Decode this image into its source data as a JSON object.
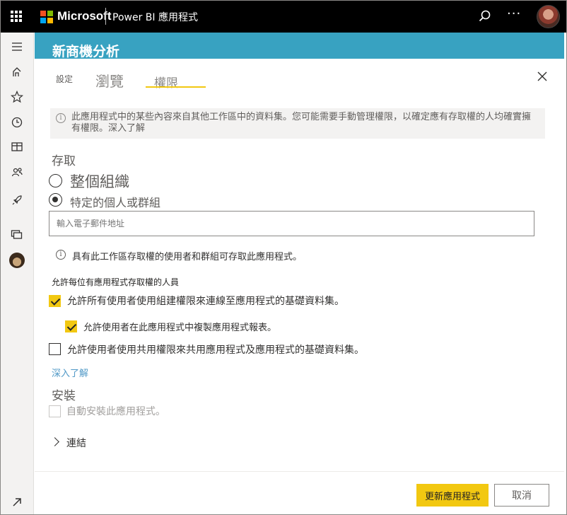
{
  "topbar": {
    "brand": "Microsoft",
    "app_name": "Power BI 應用程式",
    "more_glyph": "···"
  },
  "colors": {
    "topbar_bg": "#000000",
    "band_bg": "#38a2c1",
    "accent_yellow": "#f2c811",
    "link_blue": "#4f98c6",
    "ms_red": "#f25022",
    "ms_green": "#7fba00",
    "ms_blue": "#00a4ef",
    "ms_yellow": "#ffb900"
  },
  "rail": {
    "icons": [
      "hamburger-icon",
      "home-icon",
      "star-icon",
      "clock-icon",
      "apps-icon",
      "shared-icon",
      "rocket-icon",
      "workspaces-icon",
      "workspace-avatar",
      "expand-icon"
    ]
  },
  "header": {
    "title": "新商機分析"
  },
  "tabs": {
    "settings": "設定",
    "browse": "瀏覽",
    "permissions": "權限"
  },
  "info": {
    "message": "此應用程式中的某些內容來自其他工作區中的資料集。您可能需要手動管理權限，以確定應有存取權的人均確實擁有權限。深入了解"
  },
  "access": {
    "heading": "存取",
    "option_org": "整個組織",
    "option_specific": "特定的個人或群組",
    "selected": "option_specific",
    "email_placeholder": "輸入電子郵件地址",
    "note": "具有此工作區存取權的使用者和群組可存取此應用程式。"
  },
  "allow": {
    "heading": "允許每位有應用程式存取權的人員",
    "opt1": {
      "label": "允許所有使用者使用組建權限來連線至應用程式的基礎資料集。",
      "checked": true
    },
    "opt2": {
      "label": "允許使用者在此應用程式中複製應用程式報表。",
      "checked": true
    },
    "opt3": {
      "label": "允許使用者使用共用權限來共用應用程式及應用程式的基礎資料集。",
      "checked": false
    },
    "learn_more": "深入了解"
  },
  "install": {
    "heading": "安裝",
    "auto_install": {
      "label": "自動安裝此應用程式。",
      "checked": false,
      "disabled": true
    }
  },
  "links": {
    "label": "連結"
  },
  "footer": {
    "update_label": "更新應用程式",
    "cancel_label": "取消"
  }
}
